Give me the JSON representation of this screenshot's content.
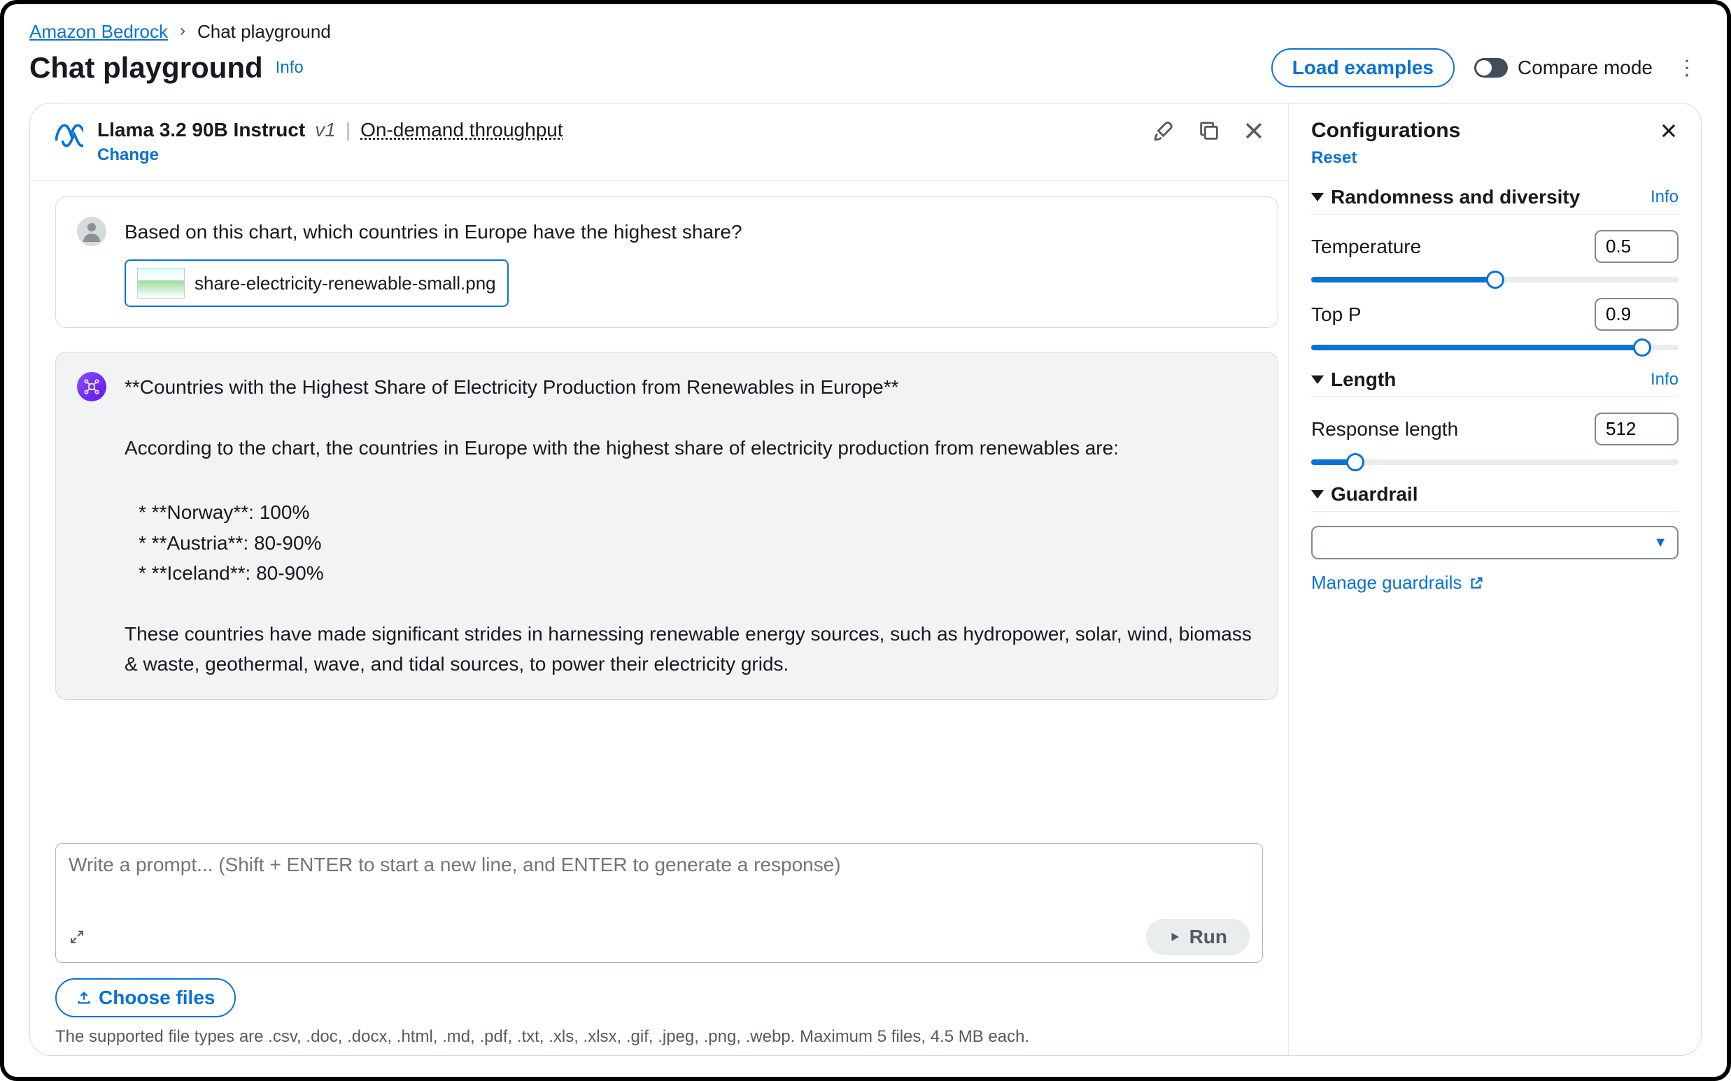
{
  "breadcrumb": {
    "root": "Amazon Bedrock",
    "current": "Chat playground"
  },
  "page": {
    "title": "Chat playground",
    "info": "Info"
  },
  "header": {
    "loadExamples": "Load examples",
    "compareMode": "Compare mode"
  },
  "model": {
    "name": "Llama 3.2 90B Instruct",
    "version": "v1",
    "throughput": "On-demand throughput",
    "change": "Change"
  },
  "userMsg": {
    "text": "Based on this chart, which countries in Europe have the highest share?",
    "attachment": "share-electricity-renewable-small.png"
  },
  "assistantMsg": {
    "heading": "**Countries with the Highest Share of Electricity Production from Renewables in Europe**",
    "lead": "According to the chart, the countries in Europe with the highest share of electricity production from renewables are:",
    "items": {
      "a": "*   **Norway**: 100%",
      "b": "*   **Austria**: 80-90%",
      "c": "*   **Iceland**: 80-90%"
    },
    "tail": "These countries have made significant strides in harnessing renewable energy sources, such as hydropower, solar, wind, biomass & waste, geothermal, wave, and tidal sources, to power their electricity grids."
  },
  "composer": {
    "placeholder": "Write a prompt... (Shift + ENTER to start a new line, and ENTER to generate a response)",
    "run": "Run",
    "chooseFiles": "Choose files",
    "hint": "The supported file types are .csv, .doc, .docx, .html, .md, .pdf, .txt, .xls, .xlsx, .gif, .jpeg, .png, .webp. Maximum 5 files, 4.5 MB each."
  },
  "config": {
    "title": "Configurations",
    "reset": "Reset",
    "randomness": {
      "title": "Randomness and diversity",
      "info": "Info",
      "temperature": {
        "label": "Temperature",
        "value": "0.5"
      },
      "topP": {
        "label": "Top P",
        "value": "0.9"
      }
    },
    "length": {
      "title": "Length",
      "info": "Info",
      "response": {
        "label": "Response length",
        "value": "512"
      }
    },
    "guardrail": {
      "title": "Guardrail",
      "manage": "Manage guardrails"
    }
  }
}
